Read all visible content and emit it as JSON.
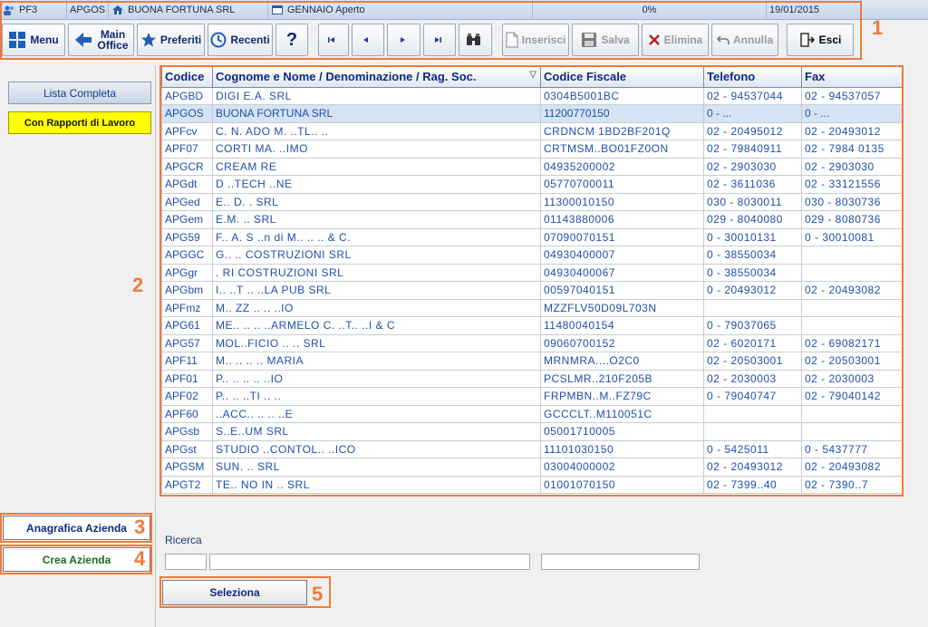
{
  "statusbar": {
    "cells": [
      "PF3",
      "APGOS",
      "BUONA FORTUNA SRL",
      "GENNAIO Aperto",
      "0%",
      "19/01/2015"
    ]
  },
  "toolbar": {
    "menu": "Menu",
    "main_office_1": "Main",
    "main_office_2": "Office",
    "preferiti": "Preferiti",
    "recenti": "Recenti",
    "help": "?",
    "inserisci": "Inserisci",
    "salva": "Salva",
    "elimina": "Elimina",
    "annulla": "Annulla",
    "esci": "Esci"
  },
  "annotations": [
    "1",
    "2",
    "3",
    "4",
    "5"
  ],
  "left_panel": {
    "lista_completa": "Lista Completa",
    "con_rapporti": "Con Rapporti di Lavoro",
    "anagrafica": "Anagrafica Azienda",
    "crea": "Crea Azienda"
  },
  "grid": {
    "columns": [
      "Codice",
      "Cognome e Nome / Denominazione / Rag. Soc.",
      "Codice Fiscale",
      "Telefono",
      "Fax"
    ],
    "rows": [
      {
        "code": "APGBD",
        "name": "DIGI E.A. SRL",
        "cf": "0304B5001BC",
        "tel": "02 - 94537044",
        "fax": "02 - 94537057"
      },
      {
        "code": "APGOS",
        "name": "BUONA FORTUNA SRL",
        "cf": "11200770150",
        "tel": "0 - ...",
        "fax": "0 - ..."
      },
      {
        "code": "APFcv",
        "name": "C. N. ADO M. ..TL.. ..",
        "cf": "CRDNCM 1BD2BF201Q",
        "tel": "02 - 20495012",
        "fax": "02 - 20493012"
      },
      {
        "code": "APF07",
        "name": "CORTI MA. ..IMO",
        "cf": "CRTMSM..BO01FZ0ON",
        "tel": "02 - 79840911",
        "fax": "02 - 7984 0135"
      },
      {
        "code": "APGCR",
        "name": "CREAM  RE",
        "cf": "04935200002",
        "tel": "02 - 2903030",
        "fax": "02 - 2903030"
      },
      {
        "code": "APGdt",
        "name": "D ..TECH ..NE",
        "cf": "05770700011",
        "tel": "02 - 3611036",
        "fax": "02 - 33121556"
      },
      {
        "code": "APGed",
        "name": "E.. D. . SRL",
        "cf": "11300010150",
        "tel": "030 - 8030011",
        "fax": "030 - 8030736"
      },
      {
        "code": "APGem",
        "name": "E.M.  ..  SRL",
        "cf": "01143880006",
        "tel": "029 - 8040080",
        "fax": "029 - 8080736"
      },
      {
        "code": "APG59",
        "name": "F.. A. S ..n di M..  .. .. & C.",
        "cf": "07090070151",
        "tel": "0 - 30010131",
        "fax": "0 - 30010081"
      },
      {
        "code": "APGGC",
        "name": "G..  .. COSTRUZIONI SRL",
        "cf": "04930400007",
        "tel": "0 - 38550034",
        "fax": ""
      },
      {
        "code": "APGgr",
        "name": ". RI  COSTRUZIONI SRL",
        "cf": "04930400067",
        "tel": "0 - 38550034",
        "fax": ""
      },
      {
        "code": "APGbm",
        "name": "I.. ..T .. ..LA PUB SRL",
        "cf": "00597040151",
        "tel": "0 - 20493012",
        "fax": "02 - 20493082"
      },
      {
        "code": "APFmz",
        "name": "M.. ZZ ..  .. ..IO",
        "cf": "MZZFLV50D09L703N",
        "tel": "",
        "fax": ""
      },
      {
        "code": "APG61",
        "name": "ME.. .. .. ..ARMELO C. ..T.. ..I & C",
        "cf": "11480040154",
        "tel": "0 - 79037065",
        "fax": ""
      },
      {
        "code": "APG57",
        "name": "MOL..FICIO .. ..  SRL",
        "cf": "09060700152",
        "tel": "02 - 6020171",
        "fax": "02 - 69082171"
      },
      {
        "code": "APF11",
        "name": "M.. .. .. ..  MARIA",
        "cf": "MRNMRA....O2C0",
        "tel": "02 - 20503001",
        "fax": "02 - 20503001"
      },
      {
        "code": "APF01",
        "name": "P.. ..  .. ..  ..IO",
        "cf": "PCSLMR..210F205B",
        "tel": "02 - 2030003",
        "fax": "02 - 2030003"
      },
      {
        "code": "APF02",
        "name": "P..  .. ..TI  .. ..",
        "cf": "FRPMBN..M..FZ79C",
        "tel": "0 - 79040747",
        "fax": "02 - 79040142"
      },
      {
        "code": "APF60",
        "name": "..ACC.. ..  .. ..E",
        "cf": "GCCCLT..M110051C",
        "tel": "",
        "fax": ""
      },
      {
        "code": "APGsb",
        "name": "S..E..UM SRL",
        "cf": "05001710005",
        "tel": "",
        "fax": ""
      },
      {
        "code": "APGst",
        "name": "STUDIO  ..CONTOL.. ..ICO",
        "cf": "11101030150",
        "tel": "0 - 5425011",
        "fax": "0 - 5437777"
      },
      {
        "code": "APGSM",
        "name": "SUN.   .. SRL",
        "cf": "03004000002",
        "tel": "02 - 20493012",
        "fax": "02 - 20493082"
      },
      {
        "code": "APGT2",
        "name": "TE.. NO IN ..  SRL",
        "cf": "01001070150",
        "tel": "02 - 7399..40",
        "fax": "02 - 7390..7"
      }
    ]
  },
  "search": {
    "label": "Ricerca",
    "code_value": "",
    "name_value": "",
    "cf_value": ""
  },
  "seleziona": "Seleziona",
  "colors": {
    "annotation": "#ef7a3c",
    "selected_row": "#d6e3f3",
    "header_text": "#0d2a80",
    "con_rapporti_bg": "#ffff00"
  }
}
